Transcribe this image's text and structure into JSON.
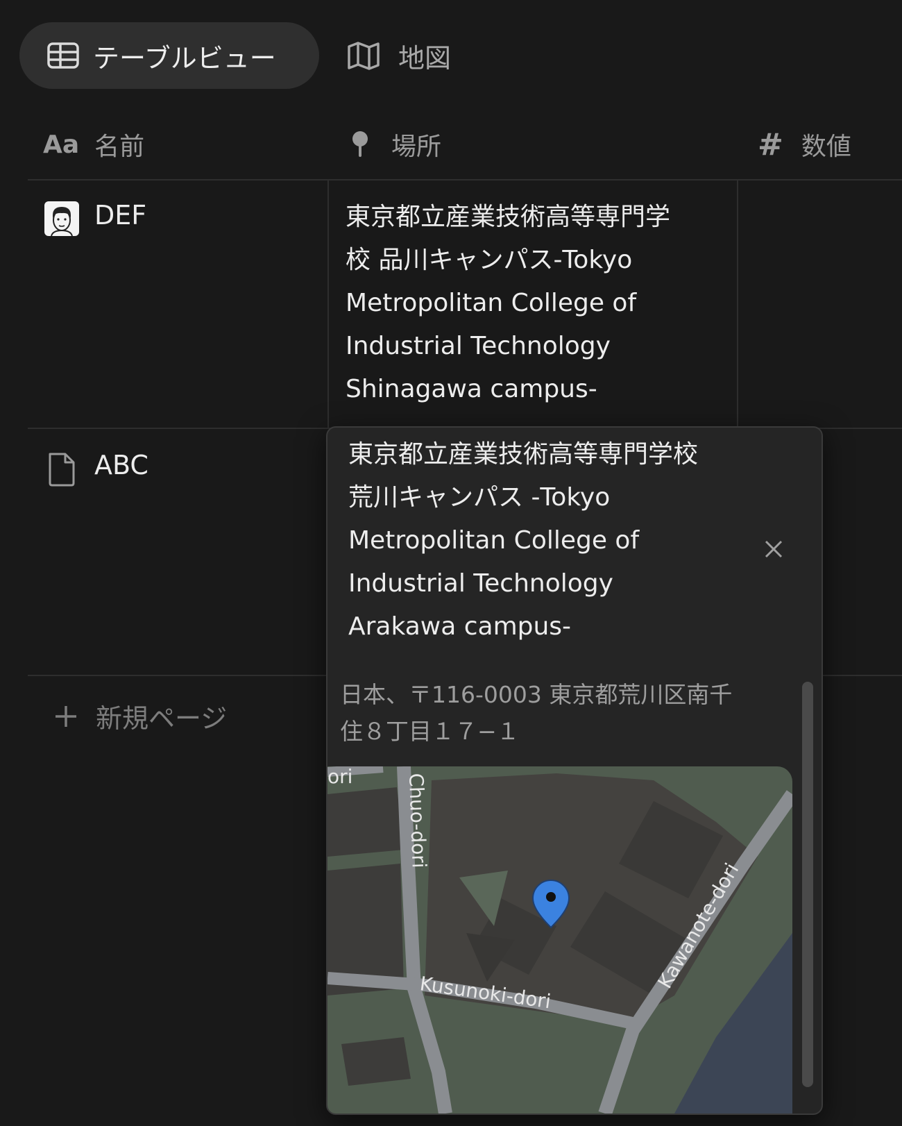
{
  "tabs": [
    {
      "label": "テーブルビュー",
      "icon": "table-icon",
      "active": true
    },
    {
      "label": "地図",
      "icon": "map-icon",
      "active": false
    }
  ],
  "columns": [
    {
      "label": "名前",
      "icon": "Aa"
    },
    {
      "label": "場所",
      "icon": "pin-icon"
    },
    {
      "label": "数値",
      "icon": "#"
    }
  ],
  "rows": [
    {
      "name": "DEF",
      "icon": "avatar",
      "place_lines": [
        "東京都立産業技術高等専門学",
        "校 品川キャンパス-Tokyo",
        "Metropolitan College of",
        "Industrial Technology",
        "Shinagawa campus-"
      ]
    },
    {
      "name": "ABC",
      "icon": "document-icon"
    }
  ],
  "new_page_label": "新規ページ",
  "popup": {
    "title_lines": [
      "東京都立産業技術高等専門学校",
      "荒川キャンパス -Tokyo",
      "Metropolitan College of",
      "Industrial Technology",
      "Arakawa campus-"
    ],
    "address_lines": [
      "日本、〒116-0003 東京都荒川区南千",
      "住８丁目１７−１"
    ],
    "map_labels": {
      "chuo": "Chuo-dori",
      "ori": "ori",
      "kusunoki": "Kusunoki-dori",
      "kawanote": "Kawanote-dori"
    }
  }
}
